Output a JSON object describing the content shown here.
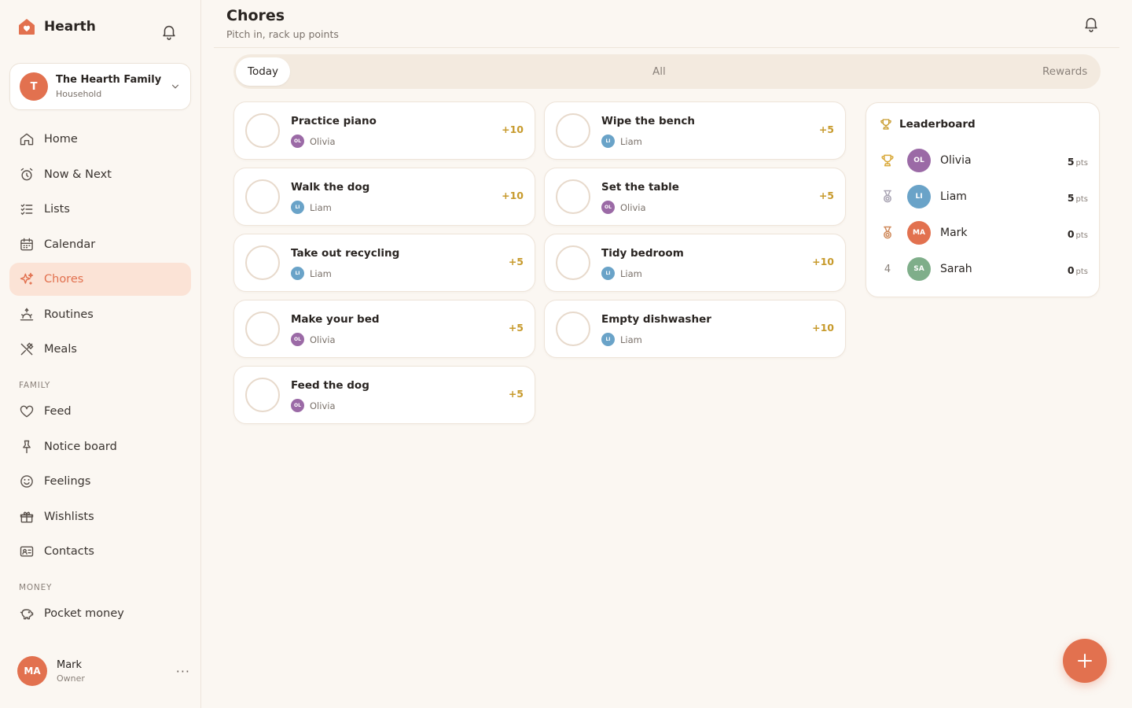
{
  "app": {
    "name": "Hearth",
    "accent": "#e2714f"
  },
  "household": {
    "initial": "T",
    "name": "The Hearth Family",
    "type": "Household"
  },
  "nav": {
    "main": [
      {
        "label": "Home",
        "icon": "home-icon"
      },
      {
        "label": "Now & Next",
        "icon": "alarm-clock-icon"
      },
      {
        "label": "Lists",
        "icon": "checklist-icon"
      },
      {
        "label": "Calendar",
        "icon": "calendar-icon"
      },
      {
        "label": "Chores",
        "icon": "sparkle-icon",
        "active": true
      },
      {
        "label": "Routines",
        "icon": "sunrise-icon"
      },
      {
        "label": "Meals",
        "icon": "utensils-icon"
      }
    ],
    "family_label": "FAMILY",
    "family": [
      {
        "label": "Feed",
        "icon": "heart-icon"
      },
      {
        "label": "Notice board",
        "icon": "pin-icon"
      },
      {
        "label": "Feelings",
        "icon": "smile-icon"
      },
      {
        "label": "Wishlists",
        "icon": "gift-icon"
      },
      {
        "label": "Contacts",
        "icon": "contact-card-icon"
      }
    ],
    "money_label": "MONEY",
    "money": [
      {
        "label": "Pocket money",
        "icon": "piggy-bank-icon"
      }
    ]
  },
  "user": {
    "initials": "MA",
    "name": "Mark",
    "role": "Owner",
    "menu": "···"
  },
  "page": {
    "title": "Chores",
    "subtitle": "Pitch in, rack up points"
  },
  "tabs": [
    {
      "label": "Today",
      "active": true
    },
    {
      "label": "All"
    },
    {
      "label": "Rewards"
    }
  ],
  "chores": [
    {
      "title": "Practice piano",
      "assignee": "Olivia",
      "initials": "OL",
      "color": "#9b6aa6",
      "points": "+10"
    },
    {
      "title": "Wipe the bench",
      "assignee": "Liam",
      "initials": "LI",
      "color": "#6aa3c8",
      "points": "+5"
    },
    {
      "title": "Walk the dog",
      "assignee": "Liam",
      "initials": "LI",
      "color": "#6aa3c8",
      "points": "+10"
    },
    {
      "title": "Set the table",
      "assignee": "Olivia",
      "initials": "OL",
      "color": "#9b6aa6",
      "points": "+5"
    },
    {
      "title": "Take out recycling",
      "assignee": "Liam",
      "initials": "LI",
      "color": "#6aa3c8",
      "points": "+5"
    },
    {
      "title": "Tidy bedroom",
      "assignee": "Liam",
      "initials": "LI",
      "color": "#6aa3c8",
      "points": "+10"
    },
    {
      "title": "Make your bed",
      "assignee": "Olivia",
      "initials": "OL",
      "color": "#9b6aa6",
      "points": "+5"
    },
    {
      "title": "Empty dishwasher",
      "assignee": "Liam",
      "initials": "LI",
      "color": "#6aa3c8",
      "points": "+10"
    },
    {
      "title": "Feed the dog",
      "assignee": "Olivia",
      "initials": "OL",
      "color": "#9b6aa6",
      "points": "+5"
    }
  ],
  "leaderboard": {
    "title": "Leaderboard",
    "unit": "pts",
    "rows": [
      {
        "rank": "1",
        "rank_icon": "gold-trophy-icon",
        "initials": "OL",
        "name": "Olivia",
        "points": "5",
        "color": "#9b6aa6"
      },
      {
        "rank": "2",
        "rank_icon": "silver-medal-icon",
        "initials": "LI",
        "name": "Liam",
        "points": "5",
        "color": "#6aa3c8"
      },
      {
        "rank": "3",
        "rank_icon": "bronze-medal-icon",
        "initials": "MA",
        "name": "Mark",
        "points": "0",
        "color": "#e2714f"
      },
      {
        "rank": "4",
        "initials": "SA",
        "name": "Sarah",
        "points": "0",
        "color": "#7fae8a"
      }
    ]
  },
  "fab": {
    "icon": "plus-icon"
  }
}
